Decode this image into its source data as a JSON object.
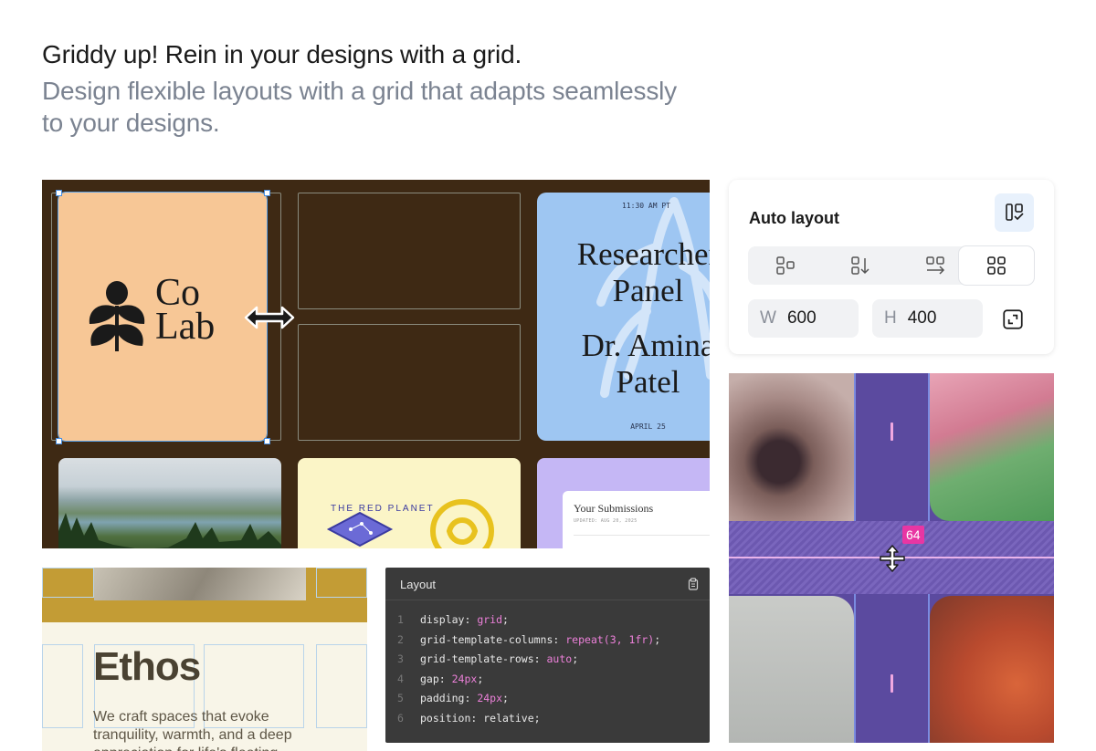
{
  "header": {
    "headline": "Griddy up! Rein in your designs with a grid.",
    "subline": "Design flexible layouts with a grid that adapts seamlessly to your designs."
  },
  "grid_showcase": {
    "colab_card": {
      "line1": "Co",
      "line2": "Lab",
      "logo_icon": "flower-logo-icon",
      "resize_icon": "horizontal-resize-arrow-icon"
    },
    "research_card": {
      "time": "11:30 AM PT",
      "title_line1": "Researcher",
      "title_line2": "Panel",
      "name_line1": "Dr. Amina",
      "name_line2": "Patel",
      "date": "APRIL 25"
    },
    "submissions_card": {
      "title": "Your Submissions",
      "updated": "UPDATED: AUG 20, 2025"
    },
    "yellow_card": {
      "badge_text": "THE RED PLANET"
    }
  },
  "auto_layout": {
    "title": "Auto layout",
    "toggle_icon": "auto-layout-toggle-icon",
    "directions": [
      {
        "name": "free-layout-icon",
        "active": false
      },
      {
        "name": "vertical-layout-icon",
        "active": false
      },
      {
        "name": "horizontal-layout-icon",
        "active": false
      },
      {
        "name": "grid-layout-icon",
        "active": true
      }
    ],
    "width_label": "W",
    "width_value": "600",
    "height_label": "H",
    "height_value": "400",
    "resize_icon": "resize-to-fit-icon"
  },
  "image_grid": {
    "gap_value": "64",
    "move_icon": "vertical-move-cursor-icon"
  },
  "ethos": {
    "word": "Ethos",
    "copy": "We craft spaces that evoke tranquility, warmth, and a deep appreciation for life's fleeting"
  },
  "code": {
    "title": "Layout",
    "copy_icon": "clipboard-icon",
    "lines": [
      {
        "n": "1",
        "prop": "display: ",
        "val": "grid",
        "end": ";"
      },
      {
        "n": "2",
        "prop": "grid-template-columns: ",
        "val": "repeat(3, 1fr)",
        "end": ";"
      },
      {
        "n": "3",
        "prop": "grid-template-rows: ",
        "val": "auto",
        "end": ";"
      },
      {
        "n": "4",
        "prop": "gap: ",
        "val": "24px",
        "end": ";"
      },
      {
        "n": "5",
        "prop": "padding: ",
        "val": "24px",
        "end": ";"
      },
      {
        "n": "6",
        "prop": "position: relative;",
        "val": "",
        "end": ""
      }
    ]
  },
  "colors": {
    "brown_bg": "#3e2914",
    "purple_bg": "#5b4a9f",
    "gap_badge": "#e836a3",
    "code_value": "#ec80d9"
  }
}
